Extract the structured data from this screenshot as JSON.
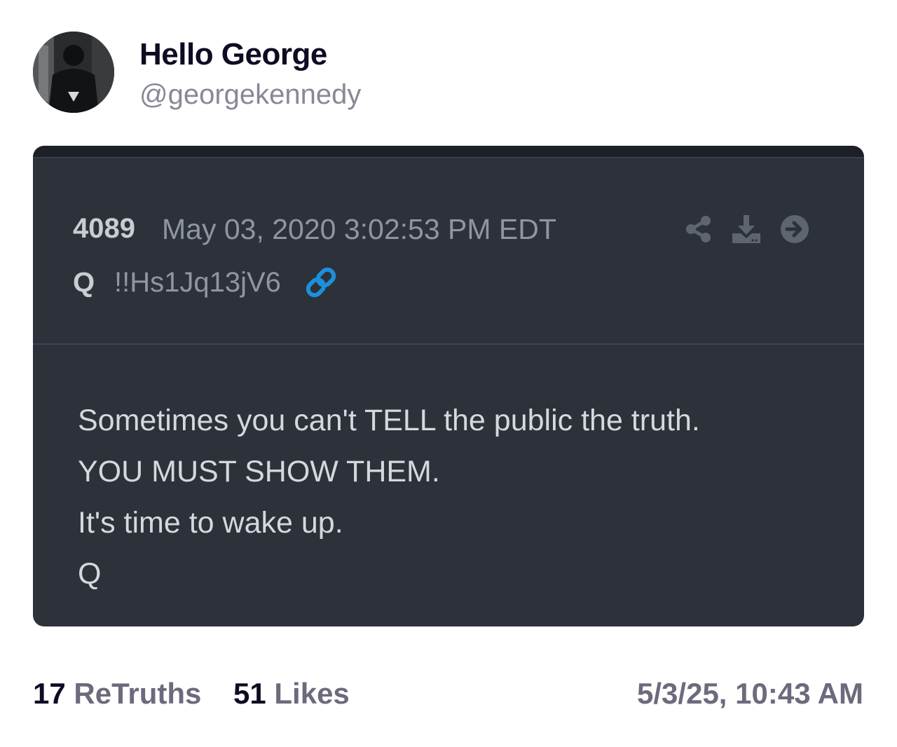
{
  "author": {
    "display_name": "Hello George",
    "handle": "@georgekennedy"
  },
  "embedded_post": {
    "number": "4089",
    "date": "May 03, 2020 3:02:53 PM EDT",
    "name": "Q",
    "tripcode": "!!Hs1Jq13jV6",
    "icons": [
      "share-icon",
      "download-icon",
      "arrow-right-circle-icon",
      "link-icon"
    ],
    "accent_color": "#1d8fdc",
    "lines": [
      "Sometimes you can't TELL the public the truth.",
      "YOU MUST SHOW THEM.",
      "It's time to wake up.",
      "Q"
    ]
  },
  "stats": {
    "retruths_count": "17",
    "retruths_label": "ReTruths",
    "likes_count": "51",
    "likes_label": "Likes"
  },
  "timestamp": "5/3/25, 10:43 AM"
}
